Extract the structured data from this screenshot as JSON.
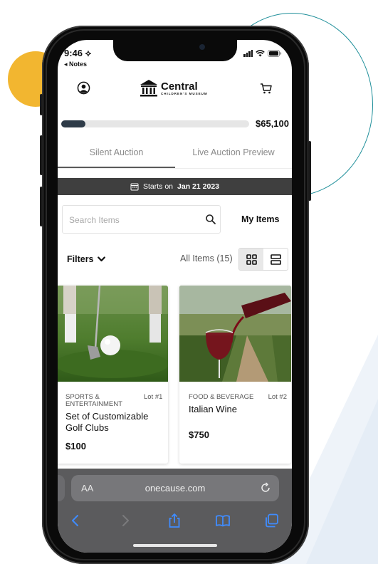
{
  "status_bar": {
    "time": "9:46 ⟡",
    "back_app": "◂ Notes"
  },
  "header": {
    "logo_name": "Central",
    "logo_sub": "CHILDREN'S MUSEUM"
  },
  "progress": {
    "amount": "$65,100",
    "fill_fraction": 0.13
  },
  "tabs": [
    {
      "label": "Silent Auction",
      "active": true
    },
    {
      "label": "Live Auction Preview",
      "active": false
    }
  ],
  "banner": {
    "prefix": "Starts on",
    "date": "Jan 21 2023"
  },
  "search": {
    "placeholder": "Search Items",
    "value": ""
  },
  "my_items_label": "My Items",
  "filters_label": "Filters",
  "all_items_label": "All Items (15)",
  "items": [
    {
      "category": "SPORTS & ENTERTAINMENT",
      "lot": "Lot #1",
      "title": "Set of Customizable Golf Clubs",
      "price": "$100"
    },
    {
      "category": "FOOD & BEVERAGE",
      "lot": "Lot #2",
      "title": "Italian Wine",
      "price": "$750"
    }
  ],
  "browser": {
    "aa_label": "AA",
    "url": "onecause.com"
  },
  "colors": {
    "accent_yellow": "#f2b630",
    "accent_teal": "#1f8f9a",
    "progress_fill": "#2e3b48",
    "banner_bg": "#3f3f3f",
    "safari_bar": "#5b5b5d",
    "safari_blue": "#3f8cff"
  }
}
